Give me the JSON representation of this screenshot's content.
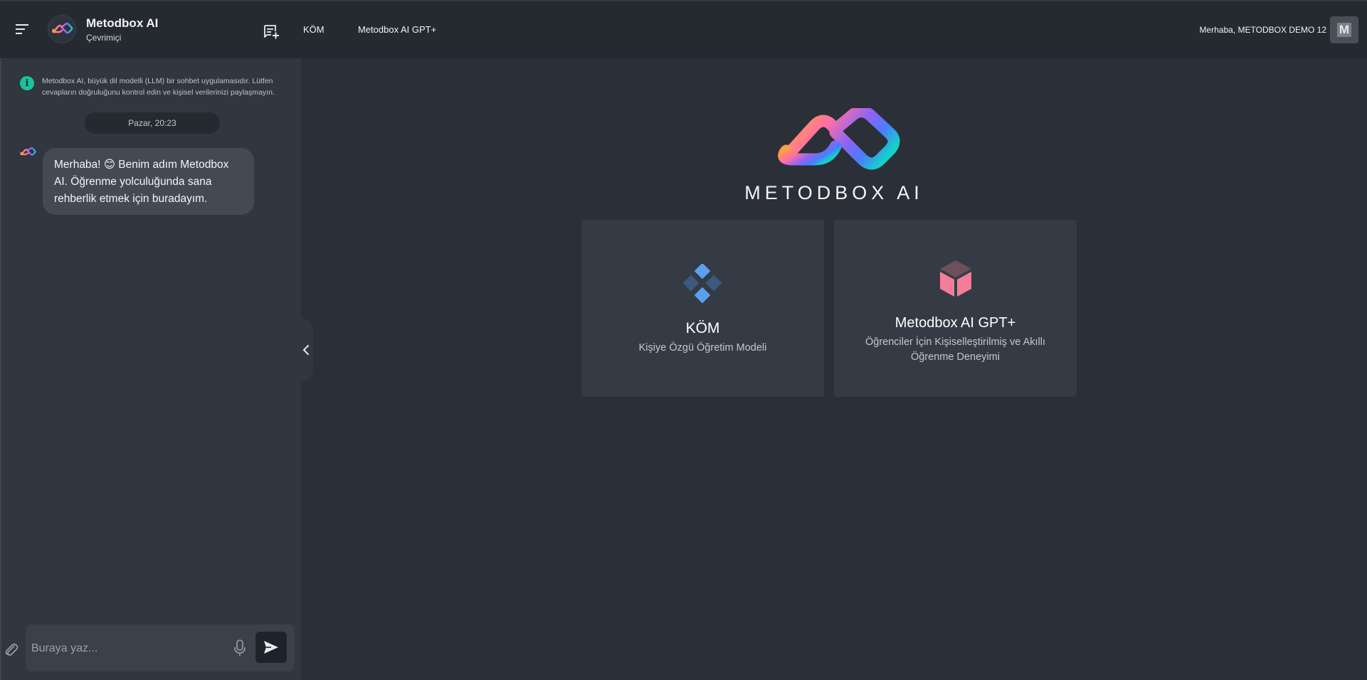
{
  "header": {
    "brand_name": "Metodbox AI",
    "brand_status": "Çevrimiçi",
    "nav": [
      {
        "label": "KÖM"
      },
      {
        "label": "Metodbox AI GPT+"
      }
    ],
    "greeting_prefix": "Merhaba,",
    "greeting_name": "METODBOX DEMO 12",
    "user_initial": "M"
  },
  "sidebar": {
    "notice": "Metodbox AI, büyük dil modelli (LLM) bir sohbet uygulamasıdır. Lütfen cevapların doğruluğunu kontrol edin ve kişisel verilerinizi paylaşmayın.",
    "date_label": "Pazar, 20:23",
    "messages": [
      {
        "sender": "bot",
        "text": "Merhaba! 😊 Benim adım Metodbox AI. Öğrenme yolculuğunda sana rehberlik etmek için buradayım."
      }
    ],
    "composer_placeholder": "Buraya yaz..."
  },
  "main": {
    "logo_text": "METODBOX AI",
    "cards": [
      {
        "title": "KÖM",
        "description": "Kişiye Özgü Öğretim Modeli",
        "icon": "diamond-grid-icon"
      },
      {
        "title": "Metodbox AI GPT+",
        "description": "Öğrenciler İçin Kişiselleştirilmiş ve Akıllı Öğrenme Deneyimi",
        "icon": "cube-icon"
      }
    ]
  },
  "colors": {
    "background": "#2b2f37",
    "topbar": "#252a31",
    "sidebar": "#31363f",
    "card": "#353b44",
    "info_accent": "#19c3a0",
    "diamond_blue": "#5aa0ef",
    "cube_pink": "#f47e98"
  }
}
